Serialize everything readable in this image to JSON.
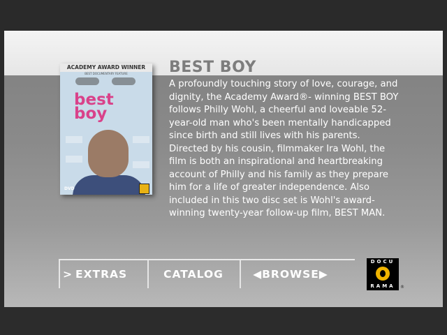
{
  "movie": {
    "title": "BEST BOY",
    "description": "A profoundly touching story of love, courage, and dignity, the Academy Award®- winning BEST BOY follows Philly Wohl, a cheerful and loveable 52-year-old man who's been mentally handicapped since birth and still lives with his parents.  Directed by his cousin, filmmaker Ira Wohl, the film is both an inspirational and heartbreaking account of Philly and his family as they prepare him for a life of greater independence. Also included in this two disc set is Wohl's award-winning twenty-year follow-up film, BEST MAN."
  },
  "cover": {
    "award_line": "ACADEMY AWARD WINNER",
    "sub_line": "BEST DOCUMENTARY FEATURE",
    "title_line1": "best",
    "title_line2": "boy",
    "format_label": "DVD"
  },
  "nav": {
    "extras": {
      "glyph": ">",
      "label": "EXTRAS"
    },
    "catalog": {
      "label": "CATALOG"
    },
    "browse": {
      "left_glyph": "◀",
      "label": "BROWSE",
      "right_glyph": "▶"
    }
  },
  "logo": {
    "top": "DOCU",
    "bottom": "RAMA",
    "registered": "®",
    "color": "#f0b400"
  },
  "colors": {
    "title": "#7d7d7d",
    "description": "#ffffff",
    "nav_text": "#ffffff"
  }
}
